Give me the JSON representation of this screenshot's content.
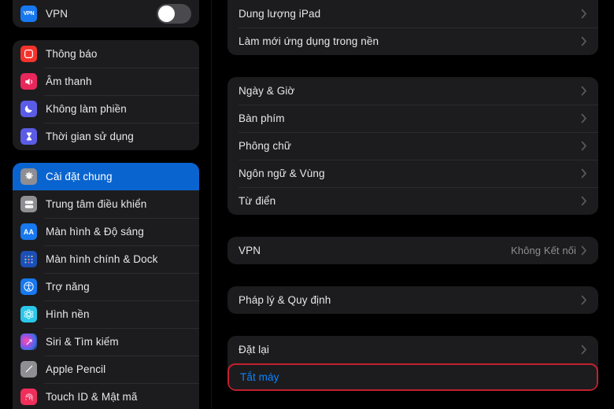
{
  "colors": {
    "background": "#000000",
    "card": "#1c1c1e",
    "selected_blue": "#0a64d0",
    "accent_blue": "#0a84ff",
    "highlight_red": "#c4202f",
    "secondary_text": "#8e8e93"
  },
  "sidebar": {
    "vpn_group": {
      "rows": [
        {
          "icon": "vpn-icon",
          "label": "VPN",
          "toggle": "off"
        }
      ]
    },
    "notifications_group": {
      "rows": [
        {
          "icon": "notifications-icon",
          "label": "Thông báo",
          "icon_color": "#f5332c"
        },
        {
          "icon": "sounds-icon",
          "label": "Âm thanh",
          "icon_color": "#e8275b"
        },
        {
          "icon": "do-not-disturb-icon",
          "label": "Không làm phiền",
          "icon_color": "#5b5ce6"
        },
        {
          "icon": "screen-time-icon",
          "label": "Thời gian sử dụng",
          "icon_color": "#5b5ce6"
        }
      ]
    },
    "general_group": {
      "rows": [
        {
          "icon": "gear-icon",
          "label": "Cài đặt chung",
          "icon_color": "#8e8e93",
          "selected": true
        },
        {
          "icon": "control-center-icon",
          "label": "Trung tâm điều khiển",
          "icon_color": "#8e8e93"
        },
        {
          "icon": "display-brightness-icon",
          "label": "Màn hình & Độ sáng",
          "icon_color": "#1778ef"
        },
        {
          "icon": "home-screen-dock-icon",
          "label": "Màn hình chính & Dock",
          "icon_color": "#1c4fb5"
        },
        {
          "icon": "accessibility-icon",
          "label": "Trợ năng",
          "icon_color": "#1778ef"
        },
        {
          "icon": "wallpaper-icon",
          "label": "Hình nền",
          "icon_color": "#2ac7e8"
        },
        {
          "icon": "siri-search-icon",
          "label": "Siri & Tìm kiếm",
          "icon_color": "#2b1b3d"
        },
        {
          "icon": "apple-pencil-icon",
          "label": "Apple Pencil",
          "icon_color": "#8e8e93"
        },
        {
          "icon": "touch-id-icon",
          "label": "Touch ID & Mật mã",
          "icon_color": "#ef2f5a"
        }
      ]
    }
  },
  "detail": {
    "group_storage": {
      "rows": [
        {
          "label": "Dung lượng iPad",
          "chevron": true
        },
        {
          "label": "Làm mới ứng dụng trong nền",
          "chevron": true
        }
      ]
    },
    "group_system": {
      "rows": [
        {
          "label": "Ngày & Giờ",
          "chevron": true
        },
        {
          "label": "Bàn phím",
          "chevron": true
        },
        {
          "label": "Phông chữ",
          "chevron": true
        },
        {
          "label": "Ngôn ngữ & Vùng",
          "chevron": true
        },
        {
          "label": "Từ điển",
          "chevron": true
        }
      ]
    },
    "group_vpn": {
      "rows": [
        {
          "label": "VPN",
          "value": "Không Kết nối",
          "chevron": true
        }
      ]
    },
    "group_legal": {
      "rows": [
        {
          "label": "Pháp lý & Quy định",
          "chevron": true
        }
      ]
    },
    "group_reset": {
      "rows": [
        {
          "label": "Đặt lại",
          "chevron": true
        },
        {
          "label": "Tắt máy",
          "chevron": false,
          "highlighted": true
        }
      ]
    }
  }
}
